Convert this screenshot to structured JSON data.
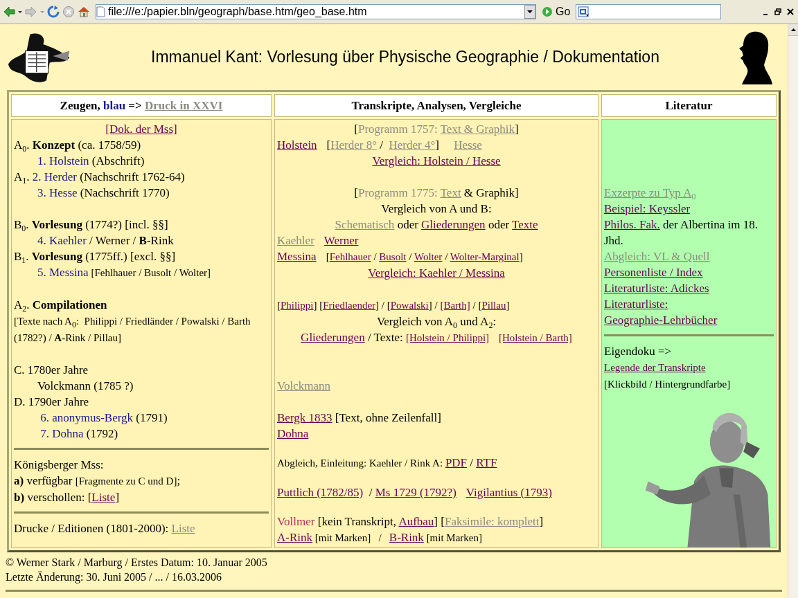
{
  "browser": {
    "address": "file:///e:/papier.bln/geograph/base.htm/geo_base.htm",
    "go_label": "Go"
  },
  "header": {
    "title": "Immanuel Kant: Vorlesung über Physische Geographie / Dokumentation"
  },
  "columns": [
    {
      "color": "#fff3b5",
      "heading": [
        {
          "kind": "text",
          "text": "Zeugen, "
        },
        {
          "kind": "blue",
          "text": "blau"
        },
        {
          "kind": "text",
          "text": " => "
        },
        {
          "kind": "dead",
          "text": "Druck in XXVI"
        }
      ],
      "sections": [
        {
          "lines": [
            {
              "kind": "centered",
              "segments": [
                {
                  "kind": "link",
                  "text": "[Dok. der Mss]"
                }
              ]
            },
            {
              "kind": "left",
              "segments": [
                {
                  "kind": "text",
                  "text": "A$_{0}$. **Konzept** (ca. 1758/59)"
                }
              ],
              "children": [
                {
                  "kind": "left",
                  "segments": [
                    {
                      "kind": "blue",
                      "text": "1. Holstein"
                    },
                    {
                      "kind": "text",
                      "text": " (Abschrift)"
                    }
                  ]
                }
              ]
            },
            {
              "kind": "left",
              "segments": [
                {
                  "kind": "text",
                  "text": "A$_{1}$. "
                },
                {
                  "kind": "blue",
                  "text": "2. Herder"
                },
                {
                  "kind": "text",
                  "text": " (Nachschrift 1762-64)"
                }
              ],
              "children": [
                {
                  "kind": "left",
                  "segments": [
                    {
                      "kind": "blue",
                      "text": "3. Hesse"
                    },
                    {
                      "kind": "text",
                      "text": " (Nachschrift 1770)"
                    }
                  ]
                }
              ]
            },
            {
              "kind": "gap"
            },
            {
              "kind": "left",
              "segments": [
                {
                  "kind": "text",
                  "text": "B$_{0}$. **Vorlesung** (1774?) [incl. §§]"
                }
              ],
              "children": [
                {
                  "kind": "left",
                  "segments": [
                    {
                      "kind": "blue",
                      "text": "4. Kaehler"
                    },
                    {
                      "kind": "text",
                      "text": " / Werner / **B**-Rink"
                    }
                  ]
                }
              ]
            },
            {
              "kind": "left",
              "segments": [
                {
                  "kind": "text",
                  "text": "B$_{1}$. **Vorlesung** (1775ff.) [excl. §§]"
                }
              ],
              "children": [
                {
                  "kind": "left",
                  "segments": [
                    {
                      "kind": "blue",
                      "text": "5. Messina"
                    },
                    {
                      "kind": "note",
                      "text": " [Fehlhauer / Busolt / Wolter]"
                    }
                  ]
                }
              ]
            },
            {
              "kind": "gap"
            },
            {
              "kind": "left",
              "segments": [
                {
                  "kind": "text",
                  "text": "A$_{2}$. **Compilationen**"
                }
              ]
            },
            {
              "kind": "left",
              "segments": [
                {
                  "kind": "note",
                  "text": "[Texte nach A$_{0}$:  Philippi / Friedländer / Powalski / Barth (1782?) / **A**-Rink / Pillau]"
                }
              ]
            },
            {
              "kind": "gap"
            },
            {
              "kind": "left",
              "segments": [
                {
                  "kind": "text",
                  "text": "C. 1780er Jahre"
                }
              ],
              "children": [
                {
                  "kind": "left",
                  "segments": [
                    {
                      "kind": "text",
                      "text": "Volckmann (1785 ?)"
                    }
                  ]
                }
              ]
            },
            {
              "kind": "left",
              "segments": [
                {
                  "kind": "text",
                  "text": "D. 1790er Jahre"
                }
              ],
              "children": [
                {
                  "kind": "left",
                  "segments": [
                    {
                      "kind": "blue",
                      "text": " 6. anonymus-Bergk"
                    },
                    {
                      "kind": "text",
                      "text": " (1791)"
                    }
                  ]
                },
                {
                  "kind": "left",
                  "segments": [
                    {
                      "kind": "blue",
                      "text": " 7. Dohna"
                    },
                    {
                      "kind": "text",
                      "text": " (1792)"
                    }
                  ]
                }
              ]
            }
          ]
        },
        {
          "lines": [
            {
              "kind": "left",
              "segments": [
                {
                  "kind": "text",
                  "text": "Königsberger Mss:"
                }
              ]
            },
            {
              "kind": "left",
              "segments": [
                {
                  "kind": "text",
                  "text": "**a)** verfügbar "
                },
                {
                  "kind": "note",
                  "text": "[Fragmente zu C und D]"
                },
                {
                  "kind": "text",
                  "text": ";"
                }
              ]
            },
            {
              "kind": "left",
              "segments": [
                {
                  "kind": "text",
                  "text": "**b)** verschollen: ["
                },
                {
                  "kind": "link",
                  "text": "Liste"
                },
                {
                  "kind": "text",
                  "text": "]"
                }
              ]
            }
          ]
        },
        {
          "lines": [
            {
              "kind": "left",
              "segments": [
                {
                  "kind": "text",
                  "text": "Drucke / Editionen (1801-2000): "
                },
                {
                  "kind": "dead",
                  "text": "Liste"
                }
              ]
            }
          ]
        }
      ]
    },
    {
      "color": "#fff3b5",
      "heading": [
        {
          "kind": "text",
          "text": "Transkripte, Analysen, Vergleiche"
        }
      ],
      "sections": [
        {
          "lines": [
            {
              "kind": "centered",
              "segments": [
                {
                  "kind": "text",
                  "text": "["
                },
                {
                  "kind": "muted",
                  "text": "Programm 1757: "
                },
                {
                  "kind": "dead",
                  "text": "Text & Graphik"
                },
                {
                  "kind": "text",
                  "text": "]"
                }
              ]
            },
            {
              "kind": "left",
              "segments": [
                {
                  "kind": "link",
                  "text": "Holstein"
                },
                {
                  "kind": "space"
                },
                {
                  "kind": "text",
                  "text": "["
                },
                {
                  "kind": "dead",
                  "text": "Herder 8°"
                },
                {
                  "kind": "text",
                  "text": " /  "
                },
                {
                  "kind": "dead",
                  "text": "Herder 4°"
                },
                {
                  "kind": "text",
                  "text": "]     "
                },
                {
                  "kind": "dead",
                  "text": "Hesse"
                }
              ]
            },
            {
              "kind": "centered",
              "segments": [
                {
                  "kind": "link",
                  "text": "Vergleich: Holstein / Hesse"
                }
              ]
            },
            {
              "kind": "gap"
            },
            {
              "kind": "centered",
              "segments": [
                {
                  "kind": "text",
                  "text": "["
                },
                {
                  "kind": "muted",
                  "text": "Programm 1775: "
                },
                {
                  "kind": "dead",
                  "text": "Text"
                },
                {
                  "kind": "text",
                  "text": " & Graphik]"
                }
              ]
            },
            {
              "kind": "centered",
              "segments": [
                {
                  "kind": "text",
                  "text": "Vergleich von A und B:"
                }
              ]
            },
            {
              "kind": "centered",
              "segments": [
                {
                  "kind": "dead",
                  "text": "Schematisch"
                },
                {
                  "kind": "text",
                  "text": " oder "
                },
                {
                  "kind": "link",
                  "text": "Gliederungen"
                },
                {
                  "kind": "text",
                  "text": " oder "
                },
                {
                  "kind": "link",
                  "text": "Texte"
                }
              ]
            },
            {
              "kind": "left",
              "segments": [
                {
                  "kind": "dead",
                  "text": "Kaehler"
                },
                {
                  "kind": "space"
                },
                {
                  "kind": "link",
                  "text": "Werner"
                }
              ]
            },
            {
              "kind": "left",
              "segments": [
                {
                  "kind": "link",
                  "text": "Messina"
                },
                {
                  "kind": "space"
                },
                {
                  "kind": "note",
                  "text": "["
                },
                {
                  "kind": "note-link",
                  "text": "Fehlhauer"
                },
                {
                  "kind": "note",
                  "text": " / "
                },
                {
                  "kind": "note-link",
                  "text": "Busolt"
                },
                {
                  "kind": "note",
                  "text": " / "
                },
                {
                  "kind": "note-link",
                  "text": "Wolter"
                },
                {
                  "kind": "note",
                  "text": " / "
                },
                {
                  "kind": "note-link",
                  "text": "Wolter-Marginal"
                },
                {
                  "kind": "note",
                  "text": "]"
                }
              ]
            },
            {
              "kind": "centered",
              "segments": [
                {
                  "kind": "link",
                  "text": "Vergleich: Kaehler / Messina"
                }
              ]
            },
            {
              "kind": "gap"
            },
            {
              "kind": "left",
              "segments": [
                {
                  "kind": "note",
                  "text": "["
                },
                {
                  "kind": "note-link",
                  "text": "Philippi"
                },
                {
                  "kind": "note",
                  "text": "] ["
                },
                {
                  "kind": "note-link",
                  "text": "Friedlaender"
                },
                {
                  "kind": "note",
                  "text": "] / ["
                },
                {
                  "kind": "note-link",
                  "text": "Powalski"
                },
                {
                  "kind": "note",
                  "text": "] / "
                },
                {
                  "kind": "note-link",
                  "text": "[Barth]"
                },
                {
                  "kind": "note",
                  "text": " / ["
                },
                {
                  "kind": "note-link",
                  "text": "Pillau"
                },
                {
                  "kind": "note",
                  "text": "]"
                }
              ]
            },
            {
              "kind": "centered",
              "segments": [
                {
                  "kind": "text",
                  "text": "Vergleich von A$_{0}$ und A$_{2}$:"
                }
              ]
            },
            {
              "kind": "centered",
              "segments": [
                {
                  "kind": "link",
                  "text": "Gliederungen"
                },
                {
                  "kind": "text",
                  "text": " / Texte: "
                },
                {
                  "kind": "note-link",
                  "text": "[Holstein / Philippi]"
                },
                {
                  "kind": "space"
                },
                {
                  "kind": "note-link",
                  "text": "[Holstein / Barth]"
                }
              ]
            },
            {
              "kind": "gap"
            },
            {
              "kind": "gap"
            },
            {
              "kind": "left",
              "segments": [
                {
                  "kind": "dead",
                  "text": "Volckmann"
                }
              ]
            },
            {
              "kind": "gap"
            },
            {
              "kind": "left",
              "segments": [
                {
                  "kind": "link",
                  "text": "Bergk 1833"
                },
                {
                  "kind": "text",
                  "text": " [Text, ohne Zeilenfall]"
                }
              ]
            },
            {
              "kind": "left",
              "segments": [
                {
                  "kind": "link",
                  "text": "Dohna"
                }
              ]
            }
          ]
        },
        {
          "lines": [
            {
              "kind": "left",
              "segments": [
                {
                  "kind": "note",
                  "text": "Abgleich, Einleitung: Kaehler / Rink A: "
                },
                {
                  "kind": "link",
                  "text": "PDF"
                },
                {
                  "kind": "text",
                  "text": " / "
                },
                {
                  "kind": "link",
                  "text": "RTF"
                }
              ]
            }
          ]
        },
        {
          "lines": [
            {
              "kind": "left",
              "segments": [
                {
                  "kind": "link",
                  "text": "Puttlich (1782/85)"
                },
                {
                  "kind": "text",
                  "text": "  / "
                },
                {
                  "kind": "link",
                  "text": "Ms 1729 (1792?)"
                },
                {
                  "kind": "space"
                },
                {
                  "kind": "link",
                  "text": "Vigilantius (1793)"
                }
              ]
            }
          ]
        },
        {
          "lines": [
            {
              "kind": "left",
              "segments": [
                {
                  "kind": "red",
                  "text": "Vollmer"
                },
                {
                  "kind": "text",
                  "text": " [kein Transkript, "
                },
                {
                  "kind": "link",
                  "text": "Aufbau"
                },
                {
                  "kind": "text",
                  "text": "] ["
                },
                {
                  "kind": "dead",
                  "text": "Faksimile: komplett"
                },
                {
                  "kind": "text",
                  "text": "]"
                }
              ]
            },
            {
              "kind": "left",
              "segments": [
                {
                  "kind": "link",
                  "text": "A-Rink"
                },
                {
                  "kind": "note",
                  "text": " [mit Marken]   /   "
                },
                {
                  "kind": "link",
                  "text": "B-Rink"
                },
                {
                  "kind": "note",
                  "text": " [mit Marken]"
                }
              ]
            }
          ]
        }
      ]
    },
    {
      "color": "#b2ffaf",
      "heading": [
        {
          "kind": "text",
          "text": "Literatur"
        }
      ],
      "sections": [
        {
          "lines": [
            {
              "kind": "gap"
            },
            {
              "kind": "gap"
            },
            {
              "kind": "gap"
            },
            {
              "kind": "gap"
            },
            {
              "kind": "left",
              "segments": [
                {
                  "kind": "dead",
                  "text": "Exzerpte zu Typ A$_{0}$"
                }
              ]
            },
            {
              "kind": "left",
              "segments": [
                {
                  "kind": "link",
                  "text": "Beispiel: Keyssler"
                }
              ]
            },
            {
              "kind": "left",
              "segments": [
                {
                  "kind": "link",
                  "text": "Philos. Fak."
                },
                {
                  "kind": "text",
                  "text": " der Albertina im 18. Jhd."
                }
              ]
            },
            {
              "kind": "left",
              "segments": [
                {
                  "kind": "dead",
                  "text": "Abgleich: VL & Quell"
                }
              ]
            },
            {
              "kind": "left",
              "segments": [
                {
                  "kind": "link",
                  "text": "Personenliste / Index"
                }
              ]
            },
            {
              "kind": "left",
              "segments": [
                {
                  "kind": "link",
                  "text": "Literaturliste: Adickes"
                }
              ]
            },
            {
              "kind": "left",
              "segments": [
                {
                  "kind": "link",
                  "text": "Literaturliste:"
                }
              ]
            },
            {
              "kind": "left",
              "segments": [
                {
                  "kind": "link",
                  "text": "Geographie-Lehrbücher"
                }
              ]
            }
          ]
        },
        {
          "lines": [
            {
              "kind": "left",
              "segments": [
                {
                  "kind": "text",
                  "text": "Eigendoku =>"
                }
              ]
            },
            {
              "kind": "left",
              "segments": [
                {
                  "kind": "note-link",
                  "text": "Legende der Transkripte"
                }
              ]
            },
            {
              "kind": "left",
              "segments": [
                {
                  "kind": "note",
                  "text": "[Klickbild / Hintergrundfarbe]"
                }
              ]
            }
          ]
        }
      ],
      "picture": {
        "kind": "picture"
      }
    }
  ],
  "footer": {
    "lines": [
      "© Werner Stark / Marburg / Erstes Datum: 10. Januar 2005",
      "Letzte Änderung: 30. Juni 2005 / ... / 16.03.2006"
    ]
  }
}
